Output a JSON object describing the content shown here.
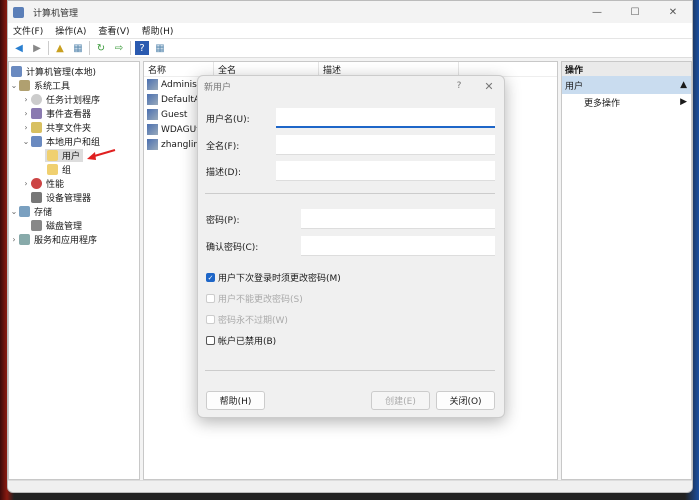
{
  "window": {
    "title": "计算机管理",
    "minimize": "—",
    "maximize": "☐",
    "close": "✕"
  },
  "menu": [
    "文件(F)",
    "操作(A)",
    "查看(V)",
    "帮助(H)"
  ],
  "tree": [
    {
      "label": "计算机管理(本地)",
      "arrow": ""
    },
    {
      "label": "系统工具",
      "arrow": "⌄"
    },
    {
      "label": "任务计划程序",
      "arrow": "›"
    },
    {
      "label": "事件查看器",
      "arrow": "›"
    },
    {
      "label": "共享文件夹",
      "arrow": "›"
    },
    {
      "label": "本地用户和组",
      "arrow": "⌄"
    },
    {
      "label": "用户",
      "arrow": ""
    },
    {
      "label": "组",
      "arrow": ""
    },
    {
      "label": "性能",
      "arrow": "›"
    },
    {
      "label": "设备管理器",
      "arrow": ""
    },
    {
      "label": "存储",
      "arrow": "⌄"
    },
    {
      "label": "磁盘管理",
      "arrow": ""
    },
    {
      "label": "服务和应用程序",
      "arrow": "›"
    }
  ],
  "list": {
    "columns": [
      "名称",
      "全名",
      "描述"
    ],
    "rows": [
      "Administr",
      "DefaultAc",
      "Guest",
      "WDAGUti",
      "zhanglin"
    ]
  },
  "actions": {
    "header": "操作",
    "section": "用户",
    "more": "更多操作"
  },
  "dialog": {
    "title": "新用户",
    "help_glyph": "?",
    "close_glyph": "✕",
    "username_label": "用户名(U):",
    "fullname_label": "全名(F):",
    "desc_label": "描述(D):",
    "password_label": "密码(P):",
    "confirm_label": "确认密码(C):",
    "checkboxes": [
      {
        "label": "用户下次登录时须更改密码(M)",
        "checked": true,
        "disabled": false
      },
      {
        "label": "用户不能更改密码(S)",
        "checked": false,
        "disabled": true
      },
      {
        "label": "密码永不过期(W)",
        "checked": false,
        "disabled": true
      },
      {
        "label": "帐户已禁用(B)",
        "checked": false,
        "disabled": false
      }
    ],
    "help_button": "帮助(H)",
    "create_button": "创建(E)",
    "close_button": "关闭(O)"
  }
}
